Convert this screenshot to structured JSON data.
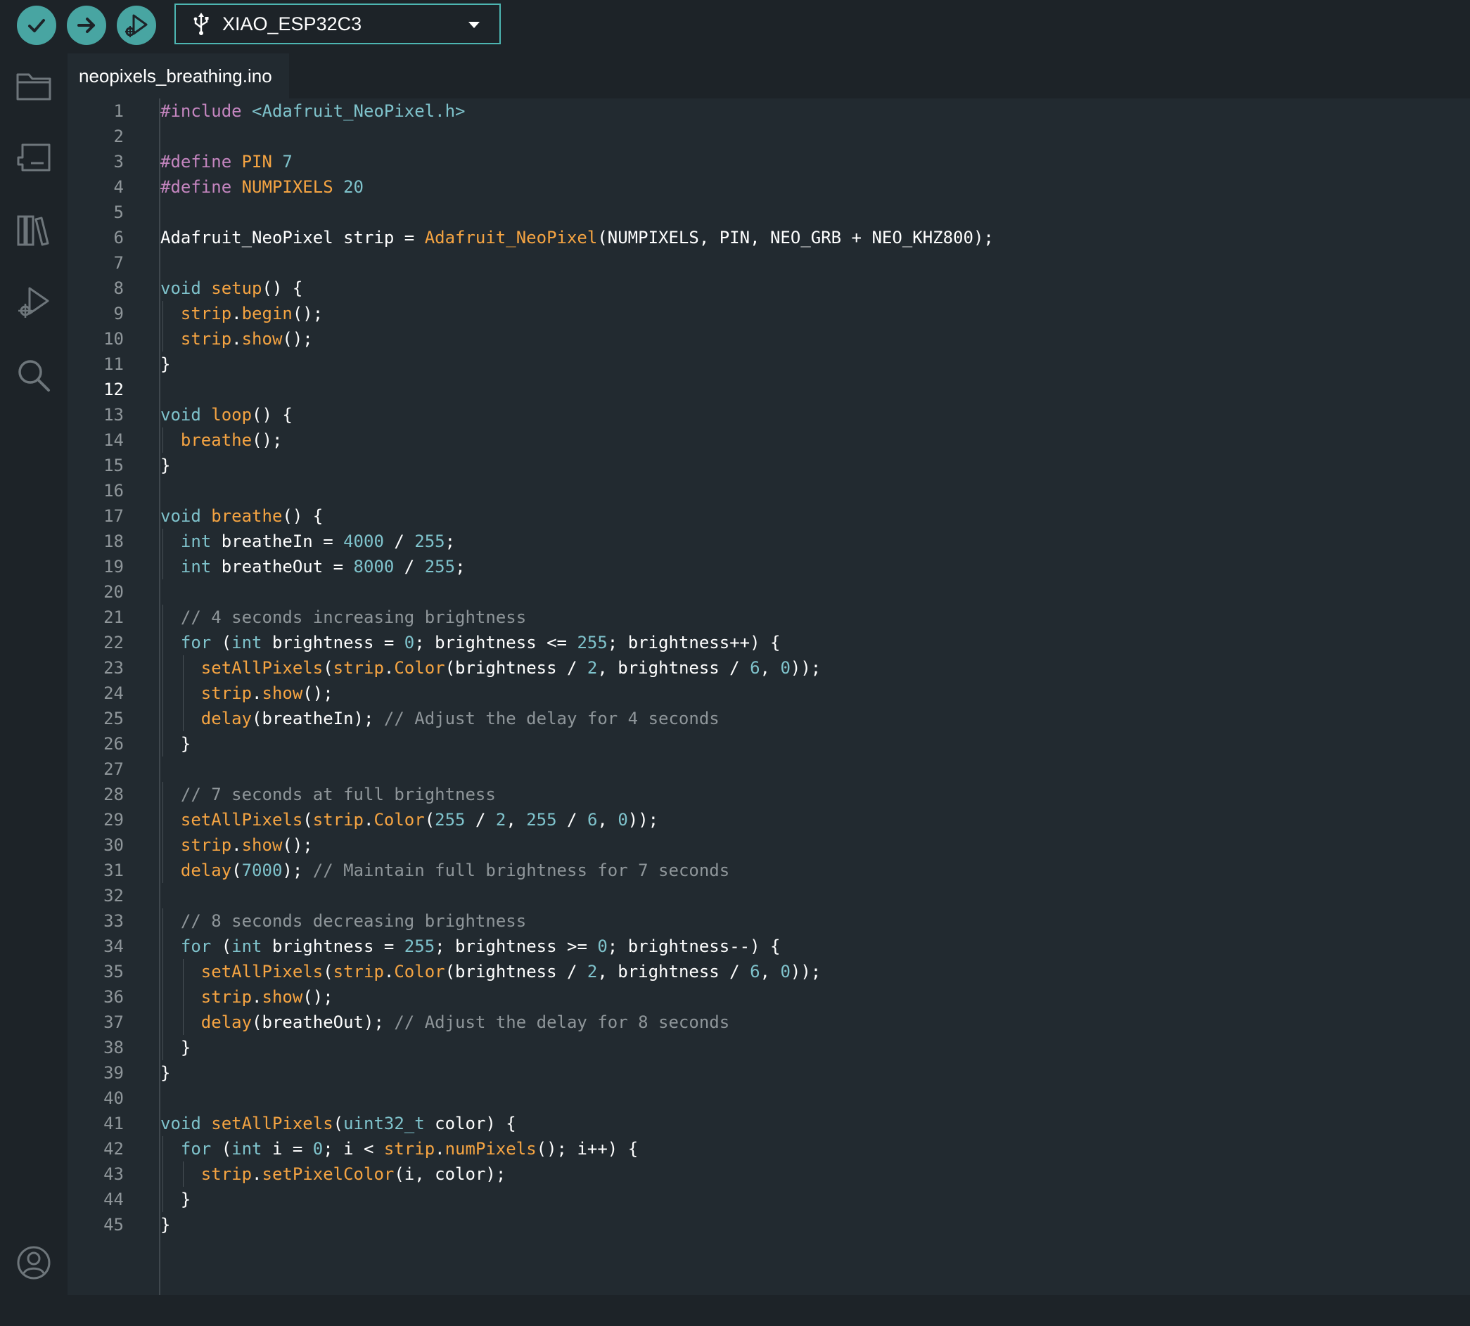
{
  "toolbar": {
    "verify_icon": "check-icon",
    "upload_icon": "arrow-right-icon",
    "debug_icon": "debug-icon",
    "board_name": "XIAO_ESP32C3"
  },
  "sidebar": {
    "items": [
      {
        "name": "sketchbook",
        "icon": "folder-icon"
      },
      {
        "name": "boards-manager",
        "icon": "board-icon"
      },
      {
        "name": "library-manager",
        "icon": "library-icon"
      },
      {
        "name": "debug",
        "icon": "debug-icon"
      },
      {
        "name": "search",
        "icon": "search-icon"
      }
    ],
    "profile_icon": "profile-icon"
  },
  "tabs": [
    {
      "label": "neopixels_breathing.ino"
    }
  ],
  "editor": {
    "active_line": 12,
    "lines": [
      [
        [
          "kw-pp",
          "#include "
        ],
        [
          "str",
          "<Adafruit_NeoPixel.h>"
        ]
      ],
      [],
      [
        [
          "kw-pp",
          "#define "
        ],
        [
          "fn",
          "PIN "
        ],
        [
          "num",
          "7"
        ]
      ],
      [
        [
          "kw-pp",
          "#define "
        ],
        [
          "fn",
          "NUMPIXELS "
        ],
        [
          "num",
          "20"
        ]
      ],
      [],
      [
        [
          "",
          "Adafruit_NeoPixel strip = "
        ],
        [
          "fn",
          "Adafruit_NeoPixel"
        ],
        [
          "",
          "(NUMPIXELS, PIN, NEO_GRB + NEO_KHZ800);"
        ]
      ],
      [],
      [
        [
          "kw",
          "void "
        ],
        [
          "fn",
          "setup"
        ],
        [
          "",
          "() {"
        ]
      ],
      [
        [
          "",
          "  "
        ],
        [
          "fn",
          "strip"
        ],
        [
          "",
          "."
        ],
        [
          "fn",
          "begin"
        ],
        [
          "",
          "();"
        ]
      ],
      [
        [
          "",
          "  "
        ],
        [
          "fn",
          "strip"
        ],
        [
          "",
          "."
        ],
        [
          "fn",
          "show"
        ],
        [
          "",
          "();"
        ]
      ],
      [
        [
          "",
          "}"
        ]
      ],
      [],
      [
        [
          "kw",
          "void "
        ],
        [
          "fn",
          "loop"
        ],
        [
          "",
          "() {"
        ]
      ],
      [
        [
          "",
          "  "
        ],
        [
          "fn",
          "breathe"
        ],
        [
          "",
          "();"
        ]
      ],
      [
        [
          "",
          "}"
        ]
      ],
      [],
      [
        [
          "kw",
          "void "
        ],
        [
          "fn",
          "breathe"
        ],
        [
          "",
          "() {"
        ]
      ],
      [
        [
          "",
          "  "
        ],
        [
          "kw",
          "int "
        ],
        [
          "",
          "breatheIn = "
        ],
        [
          "num",
          "4000"
        ],
        [
          "",
          " / "
        ],
        [
          "num",
          "255"
        ],
        [
          "",
          ";"
        ]
      ],
      [
        [
          "",
          "  "
        ],
        [
          "kw",
          "int "
        ],
        [
          "",
          "breatheOut = "
        ],
        [
          "num",
          "8000"
        ],
        [
          "",
          " / "
        ],
        [
          "num",
          "255"
        ],
        [
          "",
          ";"
        ]
      ],
      [],
      [
        [
          "",
          "  "
        ],
        [
          "cm",
          "// 4 seconds increasing brightness"
        ]
      ],
      [
        [
          "",
          "  "
        ],
        [
          "kw",
          "for "
        ],
        [
          "",
          "("
        ],
        [
          "kw",
          "int "
        ],
        [
          "",
          "brightness = "
        ],
        [
          "num",
          "0"
        ],
        [
          "",
          "; brightness <= "
        ],
        [
          "num",
          "255"
        ],
        [
          "",
          "; brightness++) {"
        ]
      ],
      [
        [
          "",
          "    "
        ],
        [
          "fn",
          "setAllPixels"
        ],
        [
          "",
          "("
        ],
        [
          "fn",
          "strip"
        ],
        [
          "",
          "."
        ],
        [
          "fn",
          "Color"
        ],
        [
          "",
          "(brightness / "
        ],
        [
          "num",
          "2"
        ],
        [
          "",
          ", brightness / "
        ],
        [
          "num",
          "6"
        ],
        [
          "",
          ", "
        ],
        [
          "num",
          "0"
        ],
        [
          "",
          "));"
        ]
      ],
      [
        [
          "",
          "    "
        ],
        [
          "fn",
          "strip"
        ],
        [
          "",
          "."
        ],
        [
          "fn",
          "show"
        ],
        [
          "",
          "();"
        ]
      ],
      [
        [
          "",
          "    "
        ],
        [
          "fn",
          "delay"
        ],
        [
          "",
          "(breatheIn); "
        ],
        [
          "cm",
          "// Adjust the delay for 4 seconds"
        ]
      ],
      [
        [
          "",
          "  }"
        ]
      ],
      [],
      [
        [
          "",
          "  "
        ],
        [
          "cm",
          "// 7 seconds at full brightness"
        ]
      ],
      [
        [
          "",
          "  "
        ],
        [
          "fn",
          "setAllPixels"
        ],
        [
          "",
          "("
        ],
        [
          "fn",
          "strip"
        ],
        [
          "",
          "."
        ],
        [
          "fn",
          "Color"
        ],
        [
          "",
          "("
        ],
        [
          "num",
          "255"
        ],
        [
          "",
          " / "
        ],
        [
          "num",
          "2"
        ],
        [
          "",
          ", "
        ],
        [
          "num",
          "255"
        ],
        [
          "",
          " / "
        ],
        [
          "num",
          "6"
        ],
        [
          "",
          ", "
        ],
        [
          "num",
          "0"
        ],
        [
          "",
          "));"
        ]
      ],
      [
        [
          "",
          "  "
        ],
        [
          "fn",
          "strip"
        ],
        [
          "",
          "."
        ],
        [
          "fn",
          "show"
        ],
        [
          "",
          "();"
        ]
      ],
      [
        [
          "",
          "  "
        ],
        [
          "fn",
          "delay"
        ],
        [
          "",
          "("
        ],
        [
          "num",
          "7000"
        ],
        [
          "",
          "); "
        ],
        [
          "cm",
          "// Maintain full brightness for 7 seconds"
        ]
      ],
      [],
      [
        [
          "",
          "  "
        ],
        [
          "cm",
          "// 8 seconds decreasing brightness"
        ]
      ],
      [
        [
          "",
          "  "
        ],
        [
          "kw",
          "for "
        ],
        [
          "",
          "("
        ],
        [
          "kw",
          "int "
        ],
        [
          "",
          "brightness = "
        ],
        [
          "num",
          "255"
        ],
        [
          "",
          "; brightness >= "
        ],
        [
          "num",
          "0"
        ],
        [
          "",
          "; brightness--) {"
        ]
      ],
      [
        [
          "",
          "    "
        ],
        [
          "fn",
          "setAllPixels"
        ],
        [
          "",
          "("
        ],
        [
          "fn",
          "strip"
        ],
        [
          "",
          "."
        ],
        [
          "fn",
          "Color"
        ],
        [
          "",
          "(brightness / "
        ],
        [
          "num",
          "2"
        ],
        [
          "",
          ", brightness / "
        ],
        [
          "num",
          "6"
        ],
        [
          "",
          ", "
        ],
        [
          "num",
          "0"
        ],
        [
          "",
          "));"
        ]
      ],
      [
        [
          "",
          "    "
        ],
        [
          "fn",
          "strip"
        ],
        [
          "",
          "."
        ],
        [
          "fn",
          "show"
        ],
        [
          "",
          "();"
        ]
      ],
      [
        [
          "",
          "    "
        ],
        [
          "fn",
          "delay"
        ],
        [
          "",
          "(breatheOut); "
        ],
        [
          "cm",
          "// Adjust the delay for 8 seconds"
        ]
      ],
      [
        [
          "",
          "  }"
        ]
      ],
      [
        [
          "",
          "}"
        ]
      ],
      [],
      [
        [
          "kw",
          "void "
        ],
        [
          "fn",
          "setAllPixels"
        ],
        [
          "",
          "("
        ],
        [
          "kw",
          "uint32_t "
        ],
        [
          "",
          "color) {"
        ]
      ],
      [
        [
          "",
          "  "
        ],
        [
          "kw",
          "for "
        ],
        [
          "",
          "("
        ],
        [
          "kw",
          "int "
        ],
        [
          "",
          "i = "
        ],
        [
          "num",
          "0"
        ],
        [
          "",
          "; i < "
        ],
        [
          "fn",
          "strip"
        ],
        [
          "",
          "."
        ],
        [
          "fn",
          "numPixels"
        ],
        [
          "",
          "(); i++) {"
        ]
      ],
      [
        [
          "",
          "    "
        ],
        [
          "fn",
          "strip"
        ],
        [
          "",
          "."
        ],
        [
          "fn",
          "setPixelColor"
        ],
        [
          "",
          "(i, color);"
        ]
      ],
      [
        [
          "",
          "  }"
        ]
      ],
      [
        [
          "",
          "}"
        ]
      ]
    ]
  }
}
